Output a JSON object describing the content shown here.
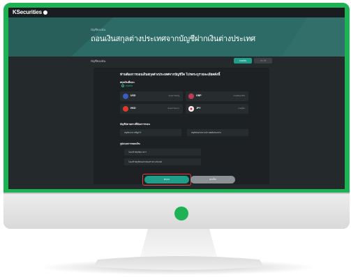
{
  "topbar": {
    "brand": "KSecurities"
  },
  "hero": {
    "breadcrumb": "บัญชีของฉัน",
    "title": "ถอนเงินสกุลต่างประเทศจากบัญชีฝากเงินต่างประเทศ"
  },
  "content": {
    "section_label": "บัญชีของฉัน",
    "tabs": [
      {
        "label": "ถอนเงิน"
      },
      {
        "label": "ประวัติ"
      }
    ]
  },
  "form": {
    "question": "ท่านต้องการถอนเงินสกุลต่างประเทศจากบัญชีใด โปรดระบุรายละเอียดดังนี้",
    "currency_section": "สกุลเงินที่ถอน",
    "selected_hint": "สกุลเงิน",
    "currencies": [
      {
        "code": "USD",
        "desc": "ดอลลาร์สหรัฐ",
        "flag": "us-flag-icon",
        "color": "#3b5bbf"
      },
      {
        "code": "GBP",
        "desc": "ปอนด์สเตอร์ลิง",
        "flag": "uk-flag-icon",
        "color": "#c23b52"
      },
      {
        "code": "HKD",
        "desc": "ดอลลาร์ฮ่องกง",
        "flag": "hk-flag-icon",
        "color": "#de3a2c"
      },
      {
        "code": "JPY",
        "desc": "เยนญี่ปุ่น",
        "flag": "jp-flag-icon",
        "color": "#f2f2f2"
      }
    ],
    "account_section": "บัญชีปลายทางที่ต้องการถอน",
    "account_options": [
      "บัญชีธนาคารที่ผูกไว้",
      "บัญชีเงินฝากต่างประเทศอื่นของท่าน"
    ],
    "method_section": "รูปแบบการถอนเงิน",
    "method_options": [
      "โอนเข้าบัญชีธนาคาร",
      "โอนเข้าบัญชีเงินฝากเงินตราต่างประเทศ"
    ],
    "ok_label": "ตกลง",
    "cancel_label": "ยกเลิก"
  }
}
